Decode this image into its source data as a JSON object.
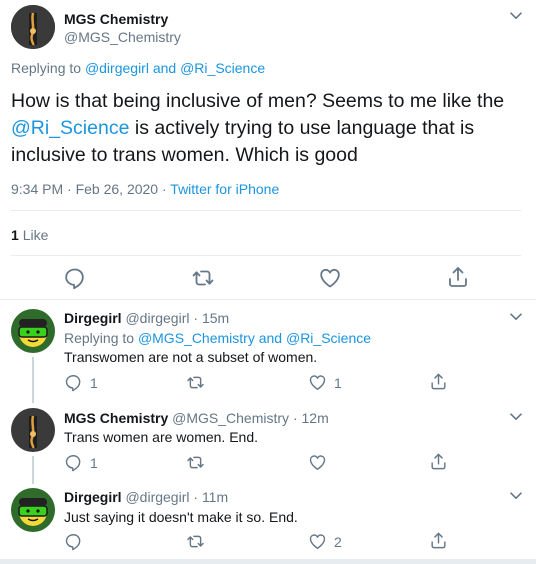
{
  "main_tweet": {
    "author_name": "MGS Chemistry",
    "author_handle": "@MGS_Chemistry",
    "replying_prefix": "Replying to",
    "replying_user1": "@dirgegirl",
    "replying_and": "and",
    "replying_user2": "@Ri_Science",
    "text_part1": "How is that being inclusive of men? Seems to me like the",
    "text_mention": "@Ri_Science",
    "text_part2": "is actively trying to use language that is inclusive to trans women. Which is good",
    "time": "9:34 PM · Feb 26, 2020",
    "source_sep": "·",
    "source": "Twitter for iPhone",
    "likes_count": "1",
    "likes_label": "Like"
  },
  "replies": [
    {
      "name": "Dirgegirl",
      "handle": "@dirgegirl",
      "sep": "·",
      "time": "15m",
      "replying_prefix": "Replying to",
      "replying_user1": "@MGS_Chemistry",
      "replying_and": "and",
      "replying_user2": "@Ri_Science",
      "text": "Transwomen are not a subset of women.",
      "reply_count": "1",
      "like_count": "1"
    },
    {
      "name": "MGS Chemistry",
      "handle": "@MGS_Chemistry",
      "sep": "·",
      "time": "12m",
      "text": "Trans women are women. End.",
      "reply_count": "1"
    },
    {
      "name": "Dirgegirl",
      "handle": "@dirgegirl",
      "sep": "·",
      "time": "11m",
      "text": "Just saying it doesn't make it so. End.",
      "like_count": "2"
    }
  ],
  "colors": {
    "link": "#1b95e0",
    "muted": "#657786",
    "text": "#14171a",
    "divider": "#e6ecf0"
  },
  "icons": [
    "chevron-down-icon",
    "reply-icon",
    "retweet-icon",
    "like-icon",
    "share-icon"
  ]
}
